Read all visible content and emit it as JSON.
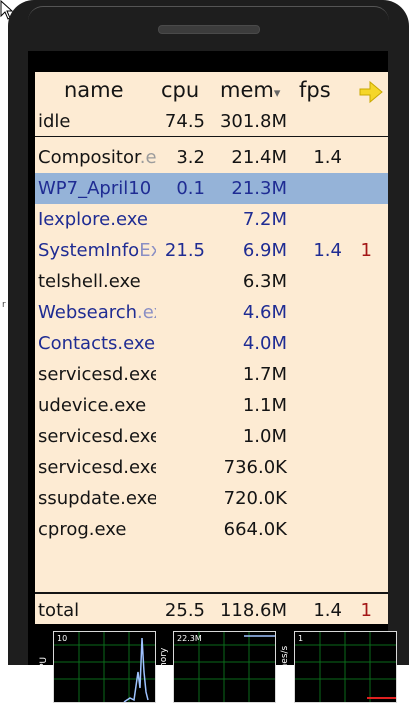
{
  "colors": {
    "list_background": "#fdebd3",
    "selected_row": "#95b3d8",
    "highlight_text": "#1f2c93",
    "alert_text": "#a31616",
    "arrow": "#f5d628",
    "graph_grid": "#0a6a1a",
    "graph_line": "#9fc2ff"
  },
  "columns": {
    "name": "name",
    "cpu": "cpu",
    "mem": "mem",
    "fps": "fps",
    "sort_indicator": "▾"
  },
  "idle": {
    "name": "idle",
    "cpu": "74.5",
    "mem": "301.8M"
  },
  "processes": [
    {
      "name": "Compositor",
      "ext": ".e",
      "cpu": "3.2",
      "mem": "21.4M",
      "fps": "1.4",
      "x": ""
    },
    {
      "name": "WP7_April10",
      "ext": "",
      "cpu": "0.1",
      "mem": "21.3M",
      "fps": "",
      "x": ""
    },
    {
      "name": "Iexplore.exe",
      "ext": "",
      "cpu": "",
      "mem": "7.2M",
      "fps": "",
      "x": ""
    },
    {
      "name": "SystemInfo",
      "ext": "Ex",
      "cpu": "21.5",
      "mem": "6.9M",
      "fps": "1.4",
      "x": "1"
    },
    {
      "name": "telshell.exe",
      "ext": "",
      "cpu": "",
      "mem": "6.3M",
      "fps": "",
      "x": ""
    },
    {
      "name": "Websearch",
      "ext": ".ex",
      "cpu": "",
      "mem": "4.6M",
      "fps": "",
      "x": ""
    },
    {
      "name": "Contacts.exe",
      "ext": "",
      "cpu": "",
      "mem": "4.0M",
      "fps": "",
      "x": ""
    },
    {
      "name": "servicesd.exe",
      "ext": "",
      "cpu": "",
      "mem": "1.7M",
      "fps": "",
      "x": ""
    },
    {
      "name": "udevice.exe",
      "ext": "",
      "cpu": "",
      "mem": "1.1M",
      "fps": "",
      "x": ""
    },
    {
      "name": "servicesd.exe",
      "ext": "",
      "cpu": "",
      "mem": "1.0M",
      "fps": "",
      "x": ""
    },
    {
      "name": "servicesd.exe",
      "ext": "",
      "cpu": "",
      "mem": "736.0K",
      "fps": "",
      "x": ""
    },
    {
      "name": "ssupdate.exe",
      "ext": "",
      "cpu": "",
      "mem": "720.0K",
      "fps": "",
      "x": ""
    },
    {
      "name": "cprog.exe",
      "ext": "",
      "cpu": "",
      "mem": "664.0K",
      "fps": "",
      "x": ""
    }
  ],
  "total": {
    "name": "total",
    "cpu": "25.5",
    "mem": "118.6M",
    "fps": "1.4",
    "x": "1"
  },
  "graphs": {
    "cpu": {
      "side_label": "CPU",
      "scale": "10"
    },
    "memory": {
      "side_label": "Memory",
      "scale": "22.3M"
    },
    "frames": {
      "side_label": "Frames/s",
      "scale": "1"
    }
  }
}
